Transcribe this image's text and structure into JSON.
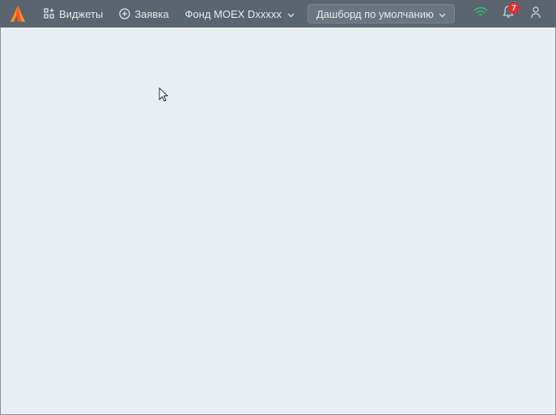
{
  "toolbar": {
    "widgets_label": "Виджеты",
    "order_label": "Заявка",
    "account_label": "Фонд MOEX Dxxxxx",
    "dashboard_label": "Дашборд по умолчанию"
  },
  "notifications": {
    "count": "7"
  },
  "colors": {
    "toolbar_bg": "#5a6570",
    "accent_orange": "#ff9020",
    "badge_red": "#e03030",
    "signal_green": "#30c070"
  }
}
